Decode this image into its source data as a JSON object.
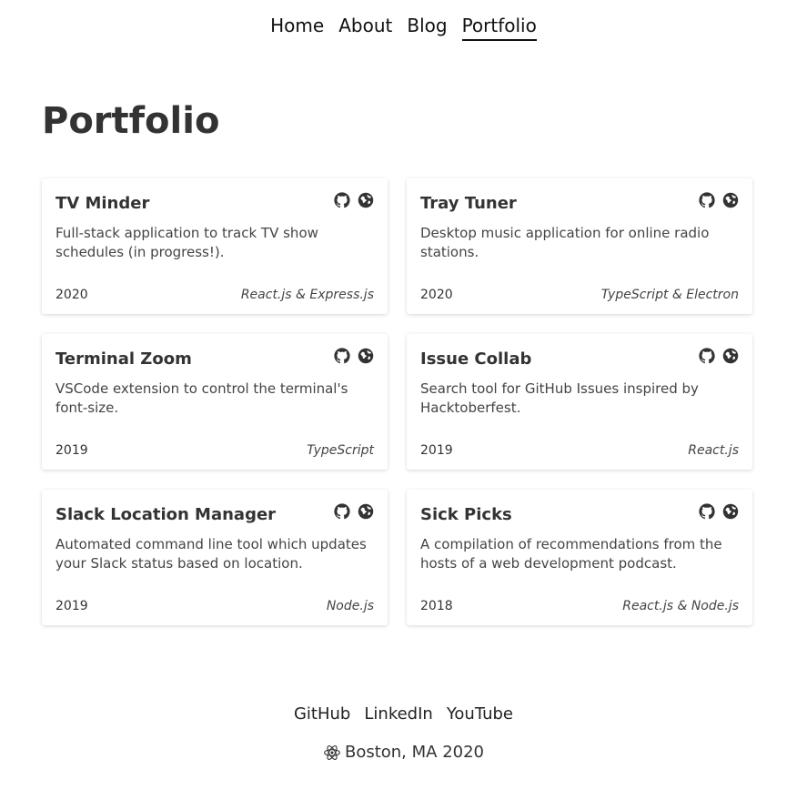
{
  "nav": {
    "items": [
      {
        "label": "Home",
        "active": false
      },
      {
        "label": "About",
        "active": false
      },
      {
        "label": "Blog",
        "active": false
      },
      {
        "label": "Portfolio",
        "active": true
      }
    ]
  },
  "page": {
    "title": "Portfolio"
  },
  "projects": [
    {
      "title": "TV Minder",
      "description": "Full-stack application to track TV show schedules (in progress!).",
      "year": "2020",
      "tech": "React.js & Express.js",
      "icons": [
        "github-icon",
        "globe-icon"
      ]
    },
    {
      "title": "Tray Tuner",
      "description": "Desktop music application for online radio stations.",
      "year": "2020",
      "tech": "TypeScript & Electron",
      "icons": [
        "github-icon",
        "globe-icon"
      ]
    },
    {
      "title": "Terminal Zoom",
      "description": "VSCode extension to control the terminal's font-size.",
      "year": "2019",
      "tech": "TypeScript",
      "icons": [
        "github-icon",
        "globe-icon"
      ]
    },
    {
      "title": "Issue Collab",
      "description": "Search tool for GitHub Issues inspired by Hacktoberfest.",
      "year": "2019",
      "tech": "React.js",
      "icons": [
        "github-icon",
        "globe-icon"
      ]
    },
    {
      "title": "Slack Location Manager",
      "description": "Automated command line tool which updates your Slack status based on location.",
      "year": "2019",
      "tech": "Node.js",
      "icons": [
        "github-icon",
        "globe-icon"
      ]
    },
    {
      "title": "Sick Picks",
      "description": "A compilation of recommendations from the hosts of a web development podcast.",
      "year": "2018",
      "tech": "React.js & Node.js",
      "icons": [
        "github-icon",
        "globe-icon"
      ]
    }
  ],
  "footer": {
    "links": [
      {
        "label": "GitHub"
      },
      {
        "label": "LinkedIn"
      },
      {
        "label": "YouTube"
      }
    ],
    "icon": "react-atom-icon",
    "copyright": "Boston, MA 2020"
  },
  "colors": {
    "text": "#333333",
    "nav_text": "#111111",
    "icon": "#333333",
    "card_background": "#ffffff"
  }
}
